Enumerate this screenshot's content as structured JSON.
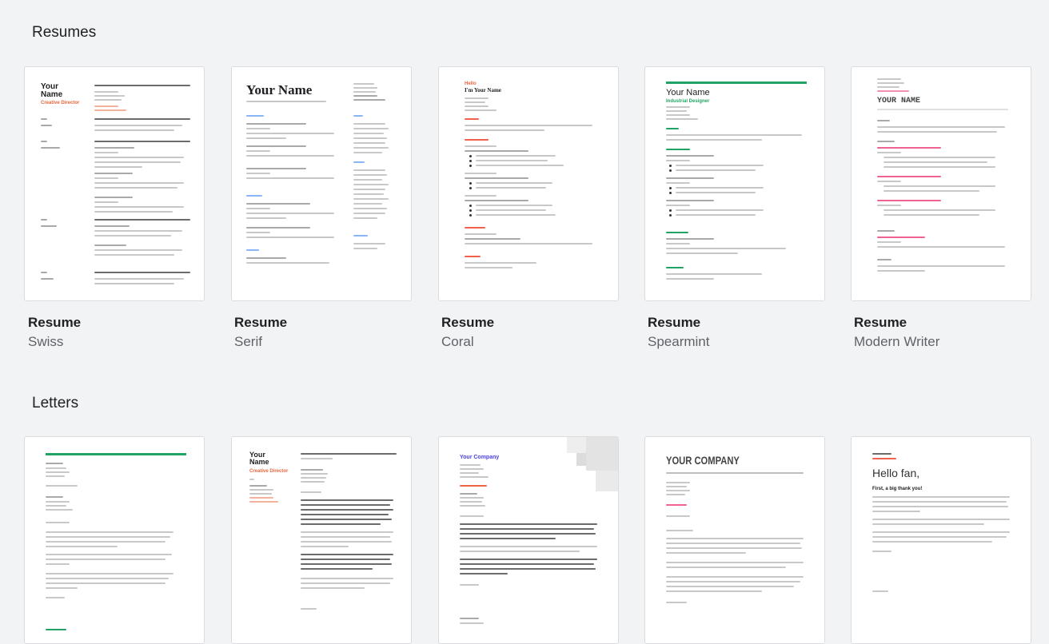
{
  "sections": {
    "resumes": {
      "title": "Resumes"
    },
    "letters": {
      "title": "Letters"
    }
  },
  "resumes": [
    {
      "title": "Resume",
      "subtitle": "Swiss"
    },
    {
      "title": "Resume",
      "subtitle": "Serif"
    },
    {
      "title": "Resume",
      "subtitle": "Coral"
    },
    {
      "title": "Resume",
      "subtitle": "Spearmint"
    },
    {
      "title": "Resume",
      "subtitle": "Modern Writer"
    }
  ],
  "thumbs": {
    "swiss": {
      "name": "Your\nName",
      "role": "Creative Director"
    },
    "serif": {
      "name": "Your Name"
    },
    "coral": {
      "hello": "Hello",
      "name": "I'm Your Name"
    },
    "spearmint": {
      "name": "Your Name",
      "role": "Industrial Designer"
    },
    "modern": {
      "name": "YOUR NAME"
    },
    "letter_swiss": {
      "name": "Your\nName",
      "role": "Creative Director"
    },
    "letter_coral": {
      "company": "Your Company"
    },
    "letter_modern": {
      "company": "YOUR COMPANY"
    },
    "letter_playful": {
      "greeting": "Hello fan,",
      "sub": "First, a big thank you!"
    }
  },
  "colors": {
    "swiss_accent": "#e8663d",
    "coral_accent": "#f2624a",
    "spearmint_accent": "#21a366",
    "modern_accent": "#e91e63",
    "serif_accent": "#4285f4",
    "coral_letter_accent": "#4b43e0"
  }
}
